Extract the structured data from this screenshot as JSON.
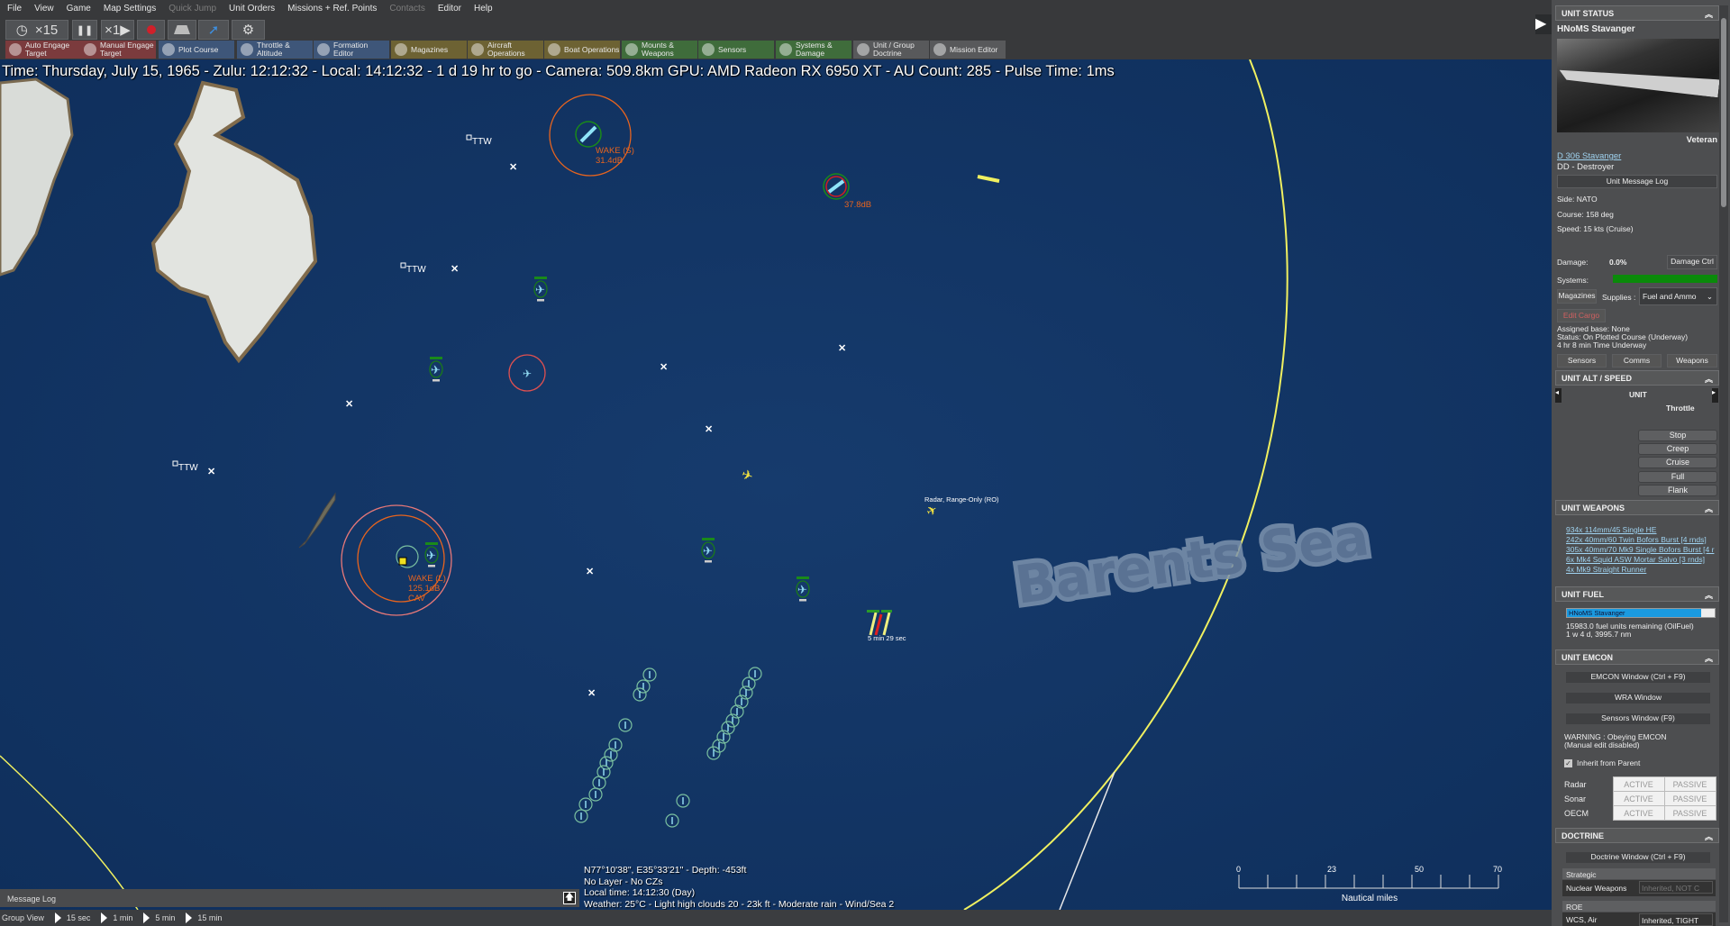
{
  "menu": [
    "File",
    "View",
    "Game",
    "Map Settings",
    "Quick Jump",
    "Unit Orders",
    "Missions + Ref. Points",
    "Contacts",
    "Editor",
    "Help"
  ],
  "toolbar1": {
    "time_compression": "×15",
    "pause": "❚❚",
    "speed": "×1▶"
  },
  "toolbar2": [
    {
      "label": "Auto Engage Target",
      "color": "red"
    },
    {
      "label": "Manual Engage Target",
      "color": "red"
    },
    {
      "label": "Plot Course",
      "color": "blue"
    },
    {
      "label": "Throttle & Altitude",
      "color": "blue"
    },
    {
      "label": "Formation Editor",
      "color": "blue"
    },
    {
      "label": "Magazines",
      "color": "olive"
    },
    {
      "label": "Aircraft Operations",
      "color": "olive"
    },
    {
      "label": "Boat Operations",
      "color": "olive"
    },
    {
      "label": "Mounts & Weapons",
      "color": "green"
    },
    {
      "label": "Sensors",
      "color": "green"
    },
    {
      "label": "Systems & Damage",
      "color": "green"
    },
    {
      "label": "Unit / Group Doctrine",
      "color": "grey"
    },
    {
      "label": "Mission Editor",
      "color": "grey"
    }
  ],
  "info_line": "Time: Thursday, July 15, 1965 - Zulu: 12:12:32 - Local: 14:12:32 - 1 d 19 hr to go - Camera: 509.8km GPU: AMD Radeon RX 6950 XT - AU Count: 285 - Pulse Time: 1ms",
  "map": {
    "ref_point_label": "TTW",
    "contact1": {
      "line1": "WAKE (S)",
      "line2": "31.4dB"
    },
    "contact2": {
      "line1": "37.8dB"
    },
    "contact3": {
      "line1": "WAKE (L)",
      "line2": "125.1dB",
      "line3": "CAV"
    },
    "radar_label": "Radar, Range-Only (RO)",
    "weapon_eta": "5 min 29 sec",
    "sea_label": "Barents Sea",
    "colors": {
      "sea": "#123565",
      "range_ring": "#f0f060",
      "detection_ring": "#e8641e",
      "friendly": "#1a7a1a",
      "aircraft": "#8fd8f0"
    }
  },
  "coords": {
    "position": "N77°10'38\", E35°33'21\" - Depth: -453ft",
    "layer": "No Layer - No CZs",
    "local_time": "Local time: 14:12:30 (Day)",
    "weather": "Weather: 25°C - Light high clouds 20 - 23k ft - Moderate rain - Wind/Sea 2"
  },
  "scale": {
    "ticks": [
      "0",
      "23",
      "50",
      "70"
    ],
    "unit": "Nautical miles"
  },
  "message_log": {
    "label": "Message Log"
  },
  "bottom": {
    "group_view": "Group View",
    "steps": [
      "15 sec",
      "1 min",
      "5 min",
      "15 min"
    ]
  },
  "panel": {
    "unit_status": {
      "header": "UNIT STATUS",
      "name": "HNoMS Stavanger",
      "proficiency": "Veteran",
      "class_link": "D 306 Stavanger",
      "type": "DD - Destroyer",
      "message_log_btn": "Unit Message Log",
      "side": "Side: NATO",
      "course": "Course: 158 deg",
      "speed": "Speed: 15 kts (Cruise)",
      "damage_label": "Damage:",
      "damage_value": "0.0%",
      "damage_ctrl": "Damage Ctrl",
      "systems_label": "Systems:",
      "systems_health": 1.0,
      "magazines_btn": "Magazines",
      "supplies_label": "Supplies :",
      "supplies_value": "Fuel and Ammo",
      "edit_cargo": "Edit Cargo",
      "assigned_base": "Assigned base: None",
      "status": "Status: On Plotted Course (Underway)",
      "underway": "4 hr 8 min Time Underway",
      "tabs": [
        "Sensors",
        "Comms",
        "Weapons"
      ]
    },
    "alt_speed": {
      "header": "UNIT ALT / SPEED",
      "unit": "UNIT",
      "throttle": "Throttle",
      "buttons": [
        "Stop",
        "Creep",
        "Cruise",
        "Full",
        "Flank"
      ]
    },
    "weapons": {
      "header": "UNIT WEAPONS",
      "items": [
        "934x 114mm/45 Single HE",
        "242x 40mm/60 Twin Bofors Burst [4 rnds]",
        "305x 40mm/70 Mk9 Single Bofors Burst [4 r",
        "6x Mk4 Squid ASW Mortar Salvo [3 rnds]",
        "4x Mk9 Straight Runner"
      ]
    },
    "fuel": {
      "header": "UNIT FUEL",
      "bar_label": "HNoMS Stavanger",
      "fraction": 0.91,
      "remaining": "15983.0 fuel units remaining (OilFuel)",
      "endurance": "1 w 4 d, 3995.7 nm"
    },
    "emcon": {
      "header": "UNIT EMCON",
      "emcon_window": "EMCON Window (Ctrl + F9)",
      "wra_window": "WRA Window",
      "sensors_window": "Sensors Window (F9)",
      "warning1": "WARNING : Obeying EMCON",
      "warning2": "(Manual edit disabled)",
      "inherit": "Inherit from Parent",
      "inherit_checked": true,
      "rows": [
        {
          "name": "Radar",
          "active": "ACTIVE",
          "passive": "PASSIVE"
        },
        {
          "name": "Sonar",
          "active": "ACTIVE",
          "passive": "PASSIVE"
        },
        {
          "name": "OECM",
          "active": "ACTIVE",
          "passive": "PASSIVE"
        }
      ]
    },
    "doctrine": {
      "header": "DOCTRINE",
      "window_btn": "Doctrine Window (Ctrl + F9)",
      "strategic": "Strategic",
      "nuclear_label": "Nuclear Weapons",
      "nuclear_value": "Inherited, NOT C",
      "roe": "ROE",
      "wcs_air_label": "WCS, Air",
      "wcs_air_value": "Inherited, TIGHT"
    }
  }
}
